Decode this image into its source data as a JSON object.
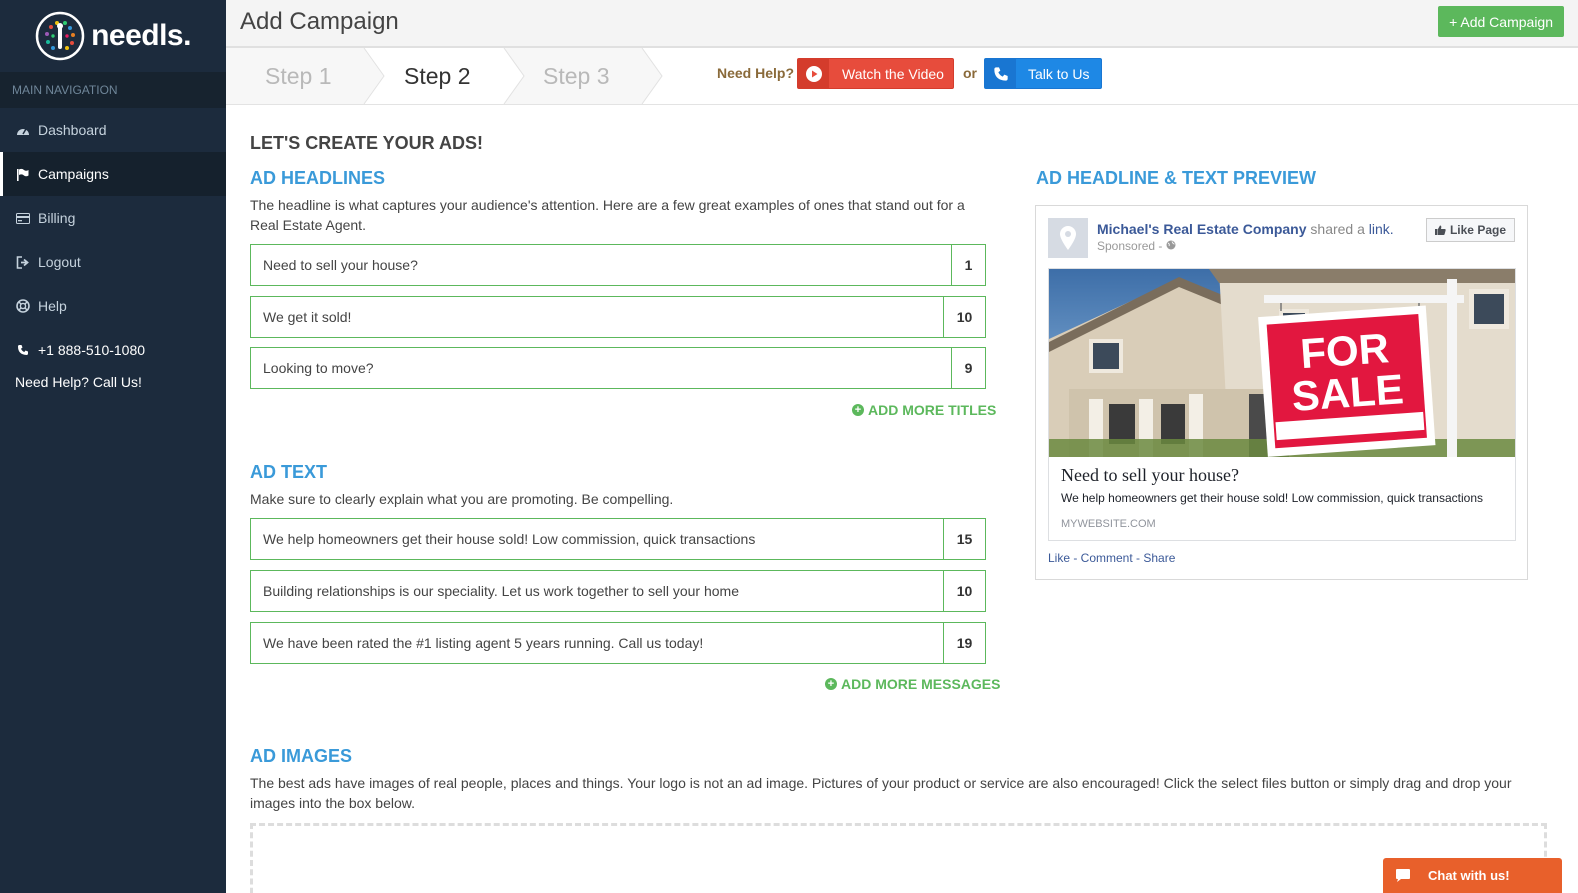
{
  "brand": {
    "name": "needls."
  },
  "sidebar": {
    "header": "MAIN NAVIGATION",
    "items": [
      {
        "label": "Dashboard",
        "icon": "dashboard-icon"
      },
      {
        "label": "Campaigns",
        "icon": "flag-icon",
        "active": true
      },
      {
        "label": "Billing",
        "icon": "credit-card-icon"
      },
      {
        "label": "Logout",
        "icon": "sign-out-icon"
      },
      {
        "label": "Help",
        "icon": "life-ring-icon"
      }
    ],
    "phone": "+1 888-510-1080",
    "call_us": "Need Help? Call Us!"
  },
  "header": {
    "title": "Add Campaign",
    "add_button": "+ Add Campaign"
  },
  "steps": {
    "items": [
      "Step 1",
      "Step 2",
      "Step 3"
    ],
    "active": "Step 2",
    "need_help": "Need Help?",
    "watch_video": "Watch the Video",
    "or": "or",
    "talk_to_us": "Talk to Us"
  },
  "main": {
    "title": "LET'S CREATE YOUR ADS!",
    "headlines": {
      "title": "AD HEADLINES",
      "description": "The headline is what captures your audience's attention. Here are a few great examples of ones that stand out for a Real Estate Agent.",
      "items": [
        {
          "value": "Need to sell your house?",
          "count": "1"
        },
        {
          "value": "We get it sold!",
          "count": "10"
        },
        {
          "value": "Looking to move?",
          "count": "9"
        }
      ],
      "add_more": "ADD MORE TITLES"
    },
    "ad_text": {
      "title": "AD TEXT",
      "description": "Make sure to clearly explain what you are promoting. Be compelling.",
      "items": [
        {
          "value": "We help homeowners get their house sold! Low commission, quick transactions",
          "count": "15"
        },
        {
          "value": "Building relationships is our speciality. Let us work together to sell your home",
          "count": "10"
        },
        {
          "value": "We have been rated the #1 listing agent 5 years running. Call us today!",
          "count": "19"
        }
      ],
      "add_more": "ADD MORE MESSAGES"
    },
    "images": {
      "title": "AD IMAGES",
      "description": "The best ads have images of real people, places and things. Your logo is not an ad image. Pictures of your product or service are also encouraged! Click the select files button or simply drag and drop your images into the box below."
    }
  },
  "preview": {
    "title": "AD HEADLINE & TEXT PREVIEW",
    "company": "Michael's Real Estate Company",
    "shared_a": "shared a",
    "link": "link.",
    "sponsored": "Sponsored -",
    "like_page": "Like Page",
    "image_text_line1": "FOR",
    "image_text_line2": "SALE",
    "headline": "Need to sell your house?",
    "text": "We help homeowners get their house sold! Low commission, quick transactions",
    "domain": "MYWEBSITE.COM",
    "actions": "Like - Comment - Share"
  },
  "chat": {
    "label": "Chat with us!"
  },
  "colors": {
    "sidebar": "#1c2b3d",
    "accent_blue": "#3a9ad9",
    "accent_green": "#5cb85c",
    "video_red": "#e74c3c",
    "talk_blue": "#1e88e5",
    "chat_orange": "#e8602b"
  }
}
